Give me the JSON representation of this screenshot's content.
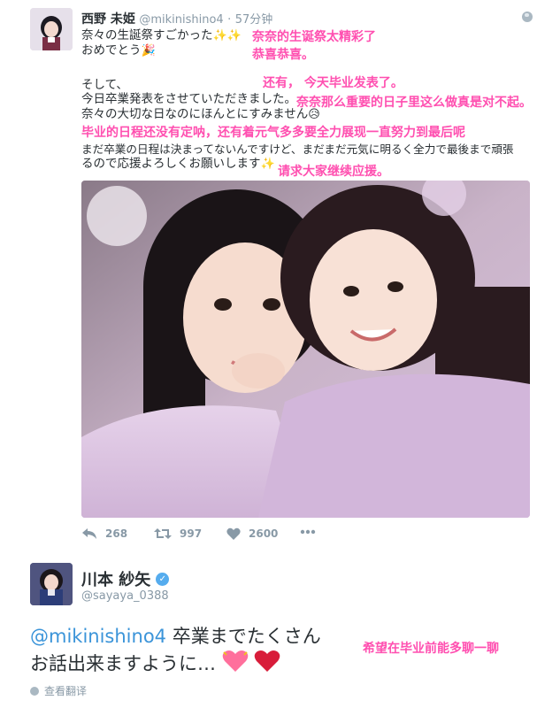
{
  "tweet": {
    "name": "西野 未姫",
    "handle": "@mikinishino4",
    "dot": "·",
    "time": "57分钟",
    "lines": [
      "奈々の生誕祭すごかった",
      "おめでとう",
      "そして、",
      "今日卒業発表をさせていただきました。",
      "奈々の大切な日なのにほんとにすみません",
      "まだ卒業の日程は決まってないんですけど、まだまだ元気に明るく全力で最後まで頑張",
      "るので応援よろしくお願いします"
    ],
    "emojis": {
      "sparkles": "✨✨",
      "confetti": "🎉",
      "sad": "😥",
      "sparkle": "✨"
    },
    "actions": {
      "retweet_count": "268",
      "like_count": "997",
      "favorite_count": "2600"
    }
  },
  "notes": {
    "n1": "奈奈的生诞祭太精彩了",
    "n2": "恭喜恭喜。",
    "n3": "还有， 今天毕业发表了。",
    "n4": "奈奈那么重要的日子里这么做真是对不起。",
    "n5": "毕业的日程还没有定呐，还有着元气多多要全力展现一直努力到最后呢",
    "n6": "请求大家继续应援。",
    "n7": "希望在毕业前能多聊一聊"
  },
  "reply": {
    "name": "川本 紗矢",
    "verified_glyph": "✓",
    "handle": "@sayaya_0388",
    "mention": "@mikinishino4",
    "line1_text": " 卒業までたくさん",
    "line2_text": "お話出来ますように…",
    "translate_label": "查看翻译"
  },
  "colors": {
    "accent_pink": "#ff4fb0",
    "link_blue": "#3b94d9",
    "muted": "#8899a6",
    "verified": "#55acee"
  }
}
